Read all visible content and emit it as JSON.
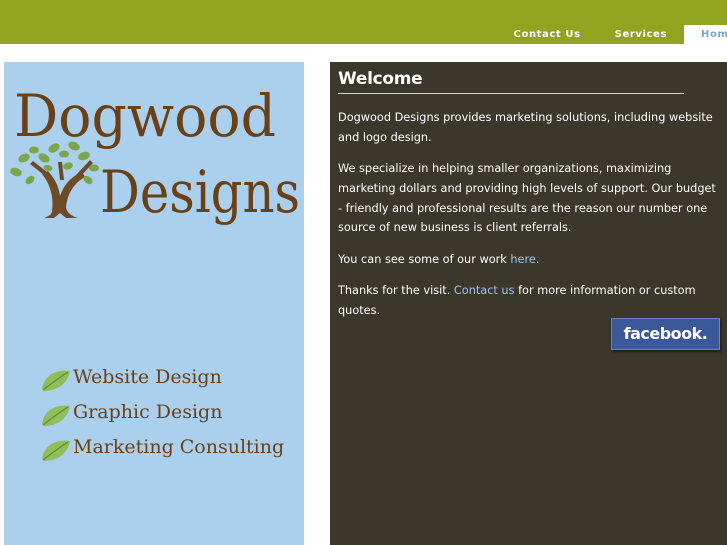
{
  "nav": {
    "items": [
      {
        "label": "Contact Us"
      },
      {
        "label": "Services"
      },
      {
        "label": "Home"
      }
    ]
  },
  "logo": {
    "line1": "Dogwood",
    "line2": "Designs"
  },
  "services": [
    {
      "label": "Website Design"
    },
    {
      "label": "Graphic Design"
    },
    {
      "label": "Marketing Consulting"
    }
  ],
  "main": {
    "title": "Welcome",
    "p1": "Dogwood Designs provides marketing solutions, including website and logo design.",
    "p2": "We specialize in helping smaller organizations, maximizing marketing dollars and providing high levels of support.  Our budget - friendly and professional results are the reason our number one source of new business is client referrals.",
    "p3_before": "You can see some of our work ",
    "p3_link": "here",
    "p3_after": ".",
    "p4_before": "Thanks for the visit.  ",
    "p4_link": "Contact us",
    "p4_after": " for more information or custom quotes.",
    "facebook_label": "facebook."
  },
  "colors": {
    "header_green": "#91a41f",
    "panel_blue": "#abd0ee",
    "main_bg": "#3c372b",
    "logo_brown": "#6a4016",
    "link_blue": "#9cc5e8",
    "facebook_blue": "#3b5998"
  }
}
